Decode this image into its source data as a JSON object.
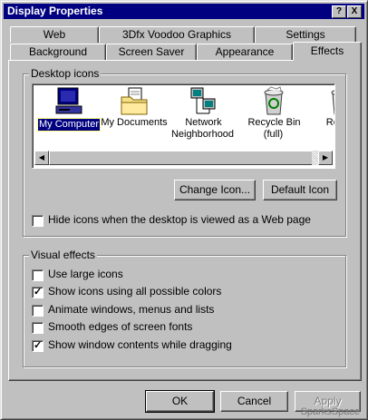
{
  "window": {
    "title": "Display Properties",
    "help_label": "?",
    "close_label": "X"
  },
  "tabs_back": [
    "Web",
    "3Dfx Voodoo Graphics",
    "Settings"
  ],
  "tabs_front": [
    "Background",
    "Screen Saver",
    "Appearance",
    "Effects"
  ],
  "active_tab": "Effects",
  "desktop_icons": {
    "legend": "Desktop icons",
    "items": [
      {
        "label": "My Computer",
        "icon": "my-computer-icon",
        "selected": true
      },
      {
        "label": "My Documents",
        "icon": "my-documents-icon"
      },
      {
        "label": "Network Neighborhood",
        "icon": "network-neighborhood-icon"
      },
      {
        "label": "Recycle Bin (full)",
        "icon": "recycle-bin-full-icon"
      },
      {
        "label": "Rec (e",
        "icon": "recycle-bin-empty-icon"
      }
    ],
    "change_icon_label": "Change Icon...",
    "default_icon_label": "Default Icon",
    "hide_icons_label": "Hide icons when the desktop is viewed as a Web page",
    "hide_icons_checked": false
  },
  "visual_effects": {
    "legend": "Visual effects",
    "options": [
      {
        "label": "Use large icons",
        "checked": false
      },
      {
        "label": "Show icons using all possible colors",
        "checked": true
      },
      {
        "label": "Animate windows, menus and lists",
        "checked": false
      },
      {
        "label": "Smooth edges of screen fonts",
        "checked": false
      },
      {
        "label": "Show window contents while dragging",
        "checked": true
      }
    ]
  },
  "buttons": {
    "ok": "OK",
    "cancel": "Cancel",
    "apply": "Apply"
  },
  "watermark": "SparksSpace"
}
